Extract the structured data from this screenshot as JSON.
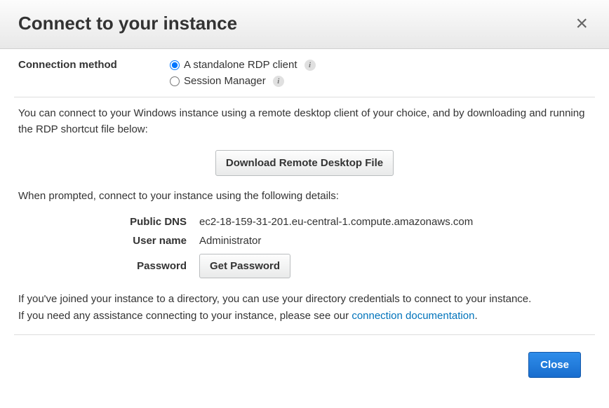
{
  "header": {
    "title": "Connect to your instance",
    "close_label": "×"
  },
  "method": {
    "section_label": "Connection method",
    "options": {
      "rdp": "A standalone RDP client",
      "session_manager": "Session Manager"
    },
    "selected": "rdp"
  },
  "instructions": {
    "intro": "You can connect to your Windows instance using a remote desktop client of your choice, and by downloading and running the RDP shortcut file below:",
    "download_button": "Download Remote Desktop File",
    "prompt_text": "When prompted, connect to your instance using the following details:"
  },
  "details": {
    "public_dns": {
      "label": "Public DNS",
      "value": "ec2-18-159-31-201.eu-central-1.compute.amazonaws.com"
    },
    "user_name": {
      "label": "User name",
      "value": "Administrator"
    },
    "password": {
      "label": "Password",
      "button": "Get Password"
    }
  },
  "help": {
    "directory_text": "If you've joined your instance to a directory, you can use your directory credentials to connect to your instance.",
    "assistance_prefix": "If you need any assistance connecting to your instance, please see our ",
    "assistance_link": "connection documentation",
    "assistance_suffix": "."
  },
  "footer": {
    "close_button": "Close"
  }
}
